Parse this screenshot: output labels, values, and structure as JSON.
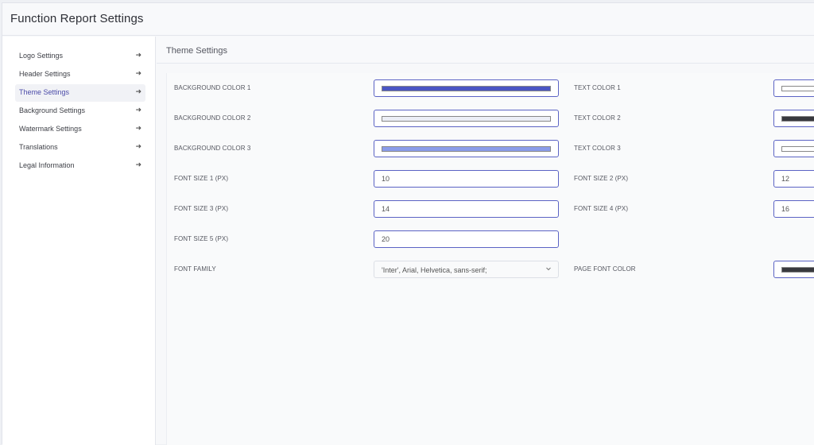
{
  "page": {
    "title": "Function Report Settings"
  },
  "sidebar": {
    "items": [
      {
        "label": "Logo Settings",
        "arrow": "➜"
      },
      {
        "label": "Header Settings",
        "arrow": "➜"
      },
      {
        "label": "Theme Settings",
        "arrow": "➜",
        "active": true
      },
      {
        "label": "Background Settings",
        "arrow": "➜"
      },
      {
        "label": "Watermark Settings",
        "arrow": "➜"
      },
      {
        "label": "Translations",
        "arrow": "➜"
      },
      {
        "label": "Legal Information",
        "arrow": "➜"
      }
    ]
  },
  "section": {
    "title": "Theme Settings"
  },
  "fields": {
    "bg1": {
      "label": "BACKGROUND COLOR 1",
      "color": "#4a55c4"
    },
    "bg2": {
      "label": "BACKGROUND COLOR 2",
      "color": "#eceef6"
    },
    "bg3": {
      "label": "BACKGROUND COLOR 3",
      "color": "#8b9cea"
    },
    "text1": {
      "label": "TEXT COLOR 1",
      "color": "#ffffff"
    },
    "text2": {
      "label": "TEXT COLOR 2",
      "color": "#38393e"
    },
    "text3": {
      "label": "TEXT COLOR 3",
      "color": "#ffffff"
    },
    "fs1": {
      "label": "FONT SIZE 1 (PX)",
      "value": "10"
    },
    "fs2": {
      "label": "FONT SIZE 2 (PX)",
      "value": "12"
    },
    "fs3": {
      "label": "FONT SIZE 3 (PX)",
      "value": "14"
    },
    "fs4": {
      "label": "FONT SIZE 4 (PX)",
      "value": "16"
    },
    "fs5": {
      "label": "FONT SIZE 5 (PX)",
      "value": "20"
    },
    "font_family": {
      "label": "FONT FAMILY",
      "value": "'Inter', Arial, Helvetica, sans-serif;",
      "icon": "chevron-down-icon"
    },
    "page_font_color": {
      "label": "PAGE FONT COLOR",
      "color": "#38393e"
    }
  }
}
